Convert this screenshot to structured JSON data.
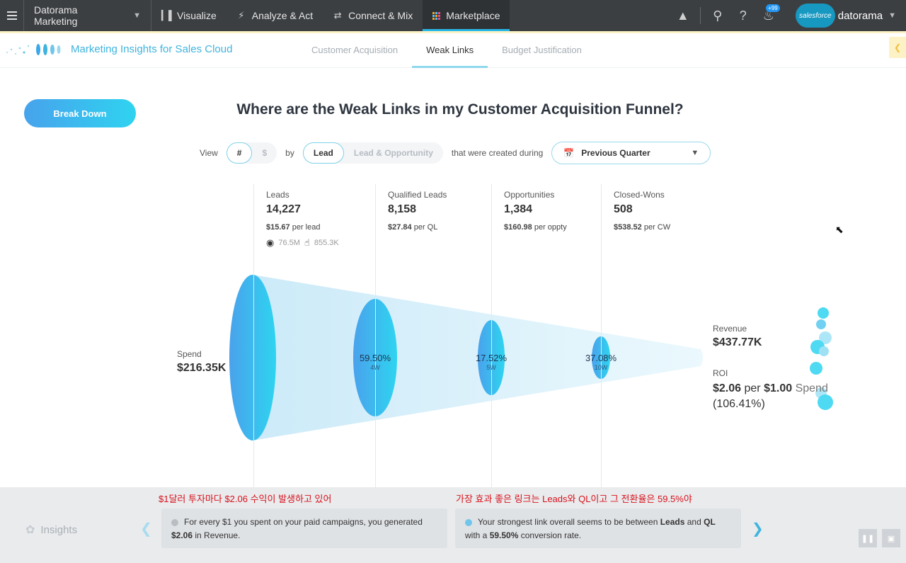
{
  "nav": {
    "workspace": "Datorama Marketing",
    "items": [
      {
        "label": "Visualize",
        "icon": "bar-chart-icon"
      },
      {
        "label": "Analyze & Act",
        "icon": "lightning-icon"
      },
      {
        "label": "Connect & Mix",
        "icon": "arrows-icon"
      },
      {
        "label": "Marketplace",
        "icon": "grid-icon"
      }
    ],
    "notifications_badge": "+99",
    "salesforce_logo_text": "salesforce",
    "brand": "datorama"
  },
  "subheader": {
    "app_title": "Marketing Insights for Sales Cloud",
    "tabs": [
      "Customer Acquisition",
      "Weak Links",
      "Budget Justification"
    ],
    "active_tab": "Weak Links"
  },
  "main": {
    "breakdown_button": "Break Down",
    "title": "Where are the Weak Links in my Customer Acquisition Funnel?",
    "filters": {
      "view_label": "View",
      "view_options": [
        "#",
        "$"
      ],
      "by_label": "by",
      "by_options": [
        "Lead",
        "Lead & Opportunity"
      ],
      "created_label": "that were created during",
      "date_value": "Previous Quarter"
    },
    "stages": [
      {
        "label": "Leads",
        "value": "14,227",
        "unit_value": "$15.67",
        "unit_label": "per lead",
        "impressions": "76.5M",
        "clicks": "855.3K"
      },
      {
        "label": "Qualified Leads",
        "value": "8,158",
        "unit_value": "$27.84",
        "unit_label": "per QL"
      },
      {
        "label": "Opportunities",
        "value": "1,384",
        "unit_value": "$160.98",
        "unit_label": "per oppty"
      },
      {
        "label": "Closed-Wons",
        "value": "508",
        "unit_value": "$538.52",
        "unit_label": "per CW"
      }
    ],
    "conversions": [
      {
        "pct": "59.50%",
        "weeks": "4W"
      },
      {
        "pct": "17.52%",
        "weeks": "5W"
      },
      {
        "pct": "37.08%",
        "weeks": "10W"
      }
    ],
    "spend": {
      "label": "Spend",
      "value": "$216.35K"
    },
    "revenue": {
      "label": "Revenue",
      "value": "$437.77K"
    },
    "roi": {
      "label": "ROI",
      "v1": "$2.06",
      "per": "per",
      "v2": "$1.00",
      "spend": "Spend",
      "pct": "(106.41%)"
    }
  },
  "insights": {
    "title": "Insights",
    "subtitle_1": "$1달러 투자마다 $2.06 수익이 발생하고 있어",
    "subtitle_2": "가장 효과 좋은 링크는 Leads와 QL이고 그 전환율은 59.5%야",
    "card1": {
      "t1": "For every $1 you spent on your paid campaigns, you generated",
      "b1": "$2.06",
      "t2": "in Revenue."
    },
    "card2": {
      "t1": "Your strongest link overall seems to be between",
      "b1": "Leads",
      "t2": "and",
      "b2": "QL",
      "t3": "with a",
      "b3": "59.50%",
      "t4": "conversion rate."
    }
  },
  "colors": {
    "accent": "#28b6e6",
    "topbar": "#3c3f42",
    "funnel_light": "#d8f1fb",
    "funnel_dark": "#3aa8ea"
  }
}
